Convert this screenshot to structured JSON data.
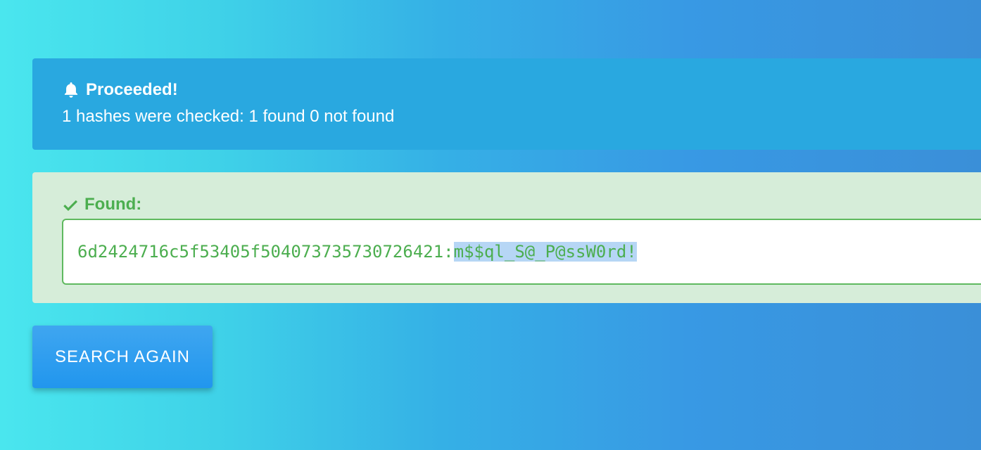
{
  "info_alert": {
    "icon": "bell-icon",
    "title": "Proceeded!",
    "message": "1 hashes were checked: 1 found 0 not found"
  },
  "result": {
    "icon": "check-icon",
    "title": "Found:",
    "hash": "6d2424716c5f53405f504073735730726421:",
    "plaintext": "m$$ql_S@_P@ssW0rd!"
  },
  "actions": {
    "search_again_label": "SEARCH AGAIN"
  },
  "colors": {
    "info_bg": "#29a8e0",
    "success_bg": "#d6edd9",
    "success_text": "#4cae4f",
    "button_bg": "#2196ee",
    "selection_highlight": "#b6d6f5"
  }
}
